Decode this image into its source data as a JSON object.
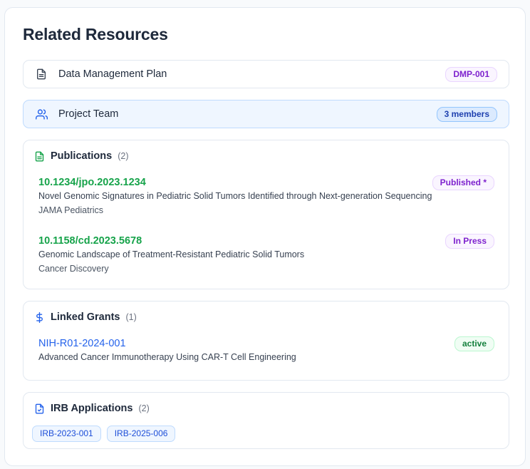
{
  "panel": {
    "title": "Related Resources"
  },
  "dmp": {
    "label": "Data Management Plan",
    "badge": "DMP-001",
    "icon": "document-icon"
  },
  "team": {
    "label": "Project Team",
    "badge": "3 members",
    "icon": "users-icon"
  },
  "publications": {
    "title": "Publications",
    "count": "(2)",
    "icon": "file-text-icon",
    "items": [
      {
        "doi": "10.1234/jpo.2023.1234",
        "title": "Novel Genomic Signatures in Pediatric Solid Tumors Identified through Next-generation Sequencing",
        "journal": "JAMA Pediatrics",
        "status": "Published *"
      },
      {
        "doi": "10.1158/cd.2023.5678",
        "title": "Genomic Landscape of Treatment-Resistant Pediatric Solid Tumors",
        "journal": "Cancer Discovery",
        "status": "In Press"
      }
    ]
  },
  "grants": {
    "title": "Linked Grants",
    "count": "(1)",
    "icon": "dollar-icon",
    "items": [
      {
        "id": "NIH-R01-2024-001",
        "title": "Advanced Cancer Immunotherapy Using CAR-T Cell Engineering",
        "status": "active"
      }
    ]
  },
  "irb": {
    "title": "IRB Applications",
    "count": "(2)",
    "icon": "file-check-icon",
    "items": [
      "IRB-2023-001",
      "IRB-2025-006"
    ]
  },
  "colors": {
    "accent_blue": "#2563eb",
    "publication_green": "#16a34a",
    "purple_badge": "#7e22ce",
    "active_green": "#15803d"
  }
}
